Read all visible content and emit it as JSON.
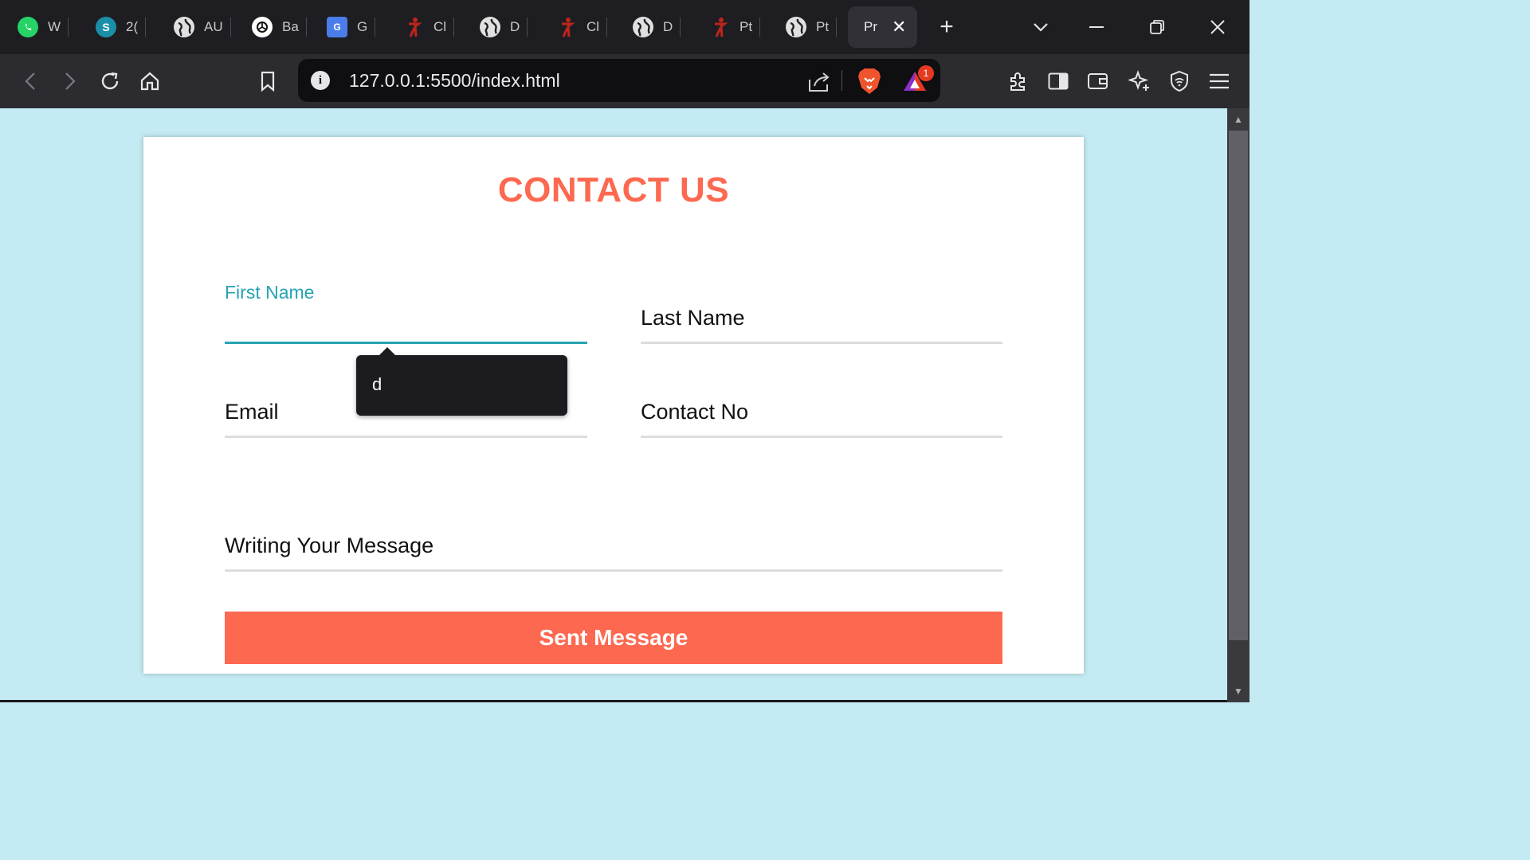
{
  "browser": {
    "tabs": [
      {
        "label": "W",
        "icon": "whatsapp-icon",
        "color": "#25d366"
      },
      {
        "label": "2(",
        "icon": "sync-icon",
        "color": "#1b8fa8"
      },
      {
        "label": "AU",
        "icon": "globe-icon",
        "color": "#e0e0e0"
      },
      {
        "label": "Ba",
        "icon": "openai-icon",
        "color": "#ffffff"
      },
      {
        "label": "G",
        "icon": "translate-icon",
        "color": "#4a7dea"
      },
      {
        "label": "Cl",
        "icon": "runner-icon",
        "color": "#c0241c"
      },
      {
        "label": "D",
        "icon": "globe-icon",
        "color": "#e0e0e0"
      },
      {
        "label": "Cl",
        "icon": "runner-icon",
        "color": "#c0241c"
      },
      {
        "label": "D",
        "icon": "globe-icon",
        "color": "#e0e0e0"
      },
      {
        "label": "Pt",
        "icon": "runner-icon",
        "color": "#c0241c"
      },
      {
        "label": "Pt",
        "icon": "globe-icon",
        "color": "#e0e0e0"
      }
    ],
    "active_tab": {
      "label": "Pr",
      "close": "✕"
    },
    "new_tab": "+",
    "url": "127.0.0.1:5500/index.html",
    "rewards_badge": "1"
  },
  "page": {
    "title": "CONTACT US",
    "fields": {
      "first_name": "First Name",
      "last_name": "Last Name",
      "email": "Email",
      "contact_no": "Contact No",
      "message": "Writing Your Message"
    },
    "autocomplete_suggestion": "d",
    "submit_label": "Sent Message"
  },
  "colors": {
    "accent": "#fd6950",
    "focus": "#27a3b3",
    "page_bg": "#c4ebf3"
  }
}
